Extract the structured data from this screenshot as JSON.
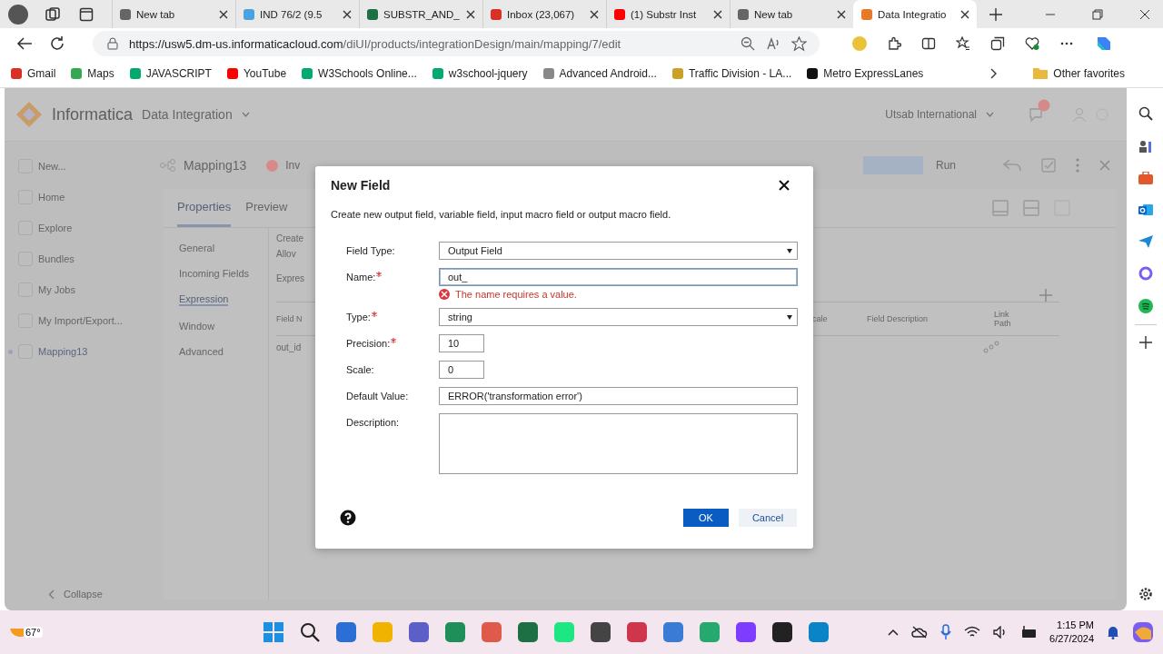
{
  "browser": {
    "tabs": [
      {
        "title": "New tab",
        "kind": "page",
        "selected": false
      },
      {
        "title": "IND 76/2 (9.5",
        "kind": "globe",
        "selected": false
      },
      {
        "title": "SUBSTR_AND_",
        "kind": "sheet",
        "selected": false
      },
      {
        "title": "Inbox (23,067)",
        "kind": "mail",
        "selected": false
      },
      {
        "title": "(1) Substr Inst",
        "kind": "video",
        "selected": false
      },
      {
        "title": "New tab",
        "kind": "page",
        "selected": false
      },
      {
        "title": "Data Integratio",
        "kind": "diamond",
        "selected": true
      }
    ],
    "url_host": "https://usw5.dm-us.informaticacloud.com",
    "url_path": "/diUI/products/integrationDesign/main/mapping/7/edit",
    "bookmarks": [
      {
        "label": "Gmail",
        "kind": "mail"
      },
      {
        "label": "Maps",
        "kind": "pin"
      },
      {
        "label": "JAVASCRIPT",
        "kind": "w3"
      },
      {
        "label": "YouTube",
        "kind": "video"
      },
      {
        "label": "W3Schools Online...",
        "kind": "w3"
      },
      {
        "label": "w3school-jquery",
        "kind": "w3"
      },
      {
        "label": "Advanced Android...",
        "kind": "g"
      },
      {
        "label": "Traffic Division - LA...",
        "kind": "building"
      },
      {
        "label": "Metro ExpressLanes",
        "kind": "metro"
      }
    ],
    "other_favorites": "Other favorites"
  },
  "app": {
    "logo": "Informatica",
    "product": "Data Integration",
    "org": "Utsab International",
    "sidebar": [
      {
        "label": "New...",
        "selected": false
      },
      {
        "label": "Home",
        "selected": false
      },
      {
        "label": "Explore",
        "selected": false
      },
      {
        "label": "Bundles",
        "selected": false
      },
      {
        "label": "My Jobs",
        "selected": false
      },
      {
        "label": "My Import/Export...",
        "selected": false
      },
      {
        "label": "Mapping13",
        "selected": true
      }
    ],
    "collapse": "Collapse",
    "mapping_name": "Mapping13",
    "status": "Inv",
    "run": "Run",
    "tabs": [
      {
        "label": "Properties",
        "selected": true
      },
      {
        "label": "Preview",
        "selected": false
      }
    ],
    "nav": [
      {
        "label": "General",
        "selected": false
      },
      {
        "label": "Incoming Fields",
        "selected": false
      },
      {
        "label": "Expression",
        "selected": true
      },
      {
        "label": "Window",
        "selected": false
      },
      {
        "label": "Advanced",
        "selected": false
      }
    ],
    "content_texts": [
      "Create",
      "Allov",
      "Expres"
    ],
    "columns": [
      "Field N",
      "cale",
      "Field Description",
      "Link Path"
    ],
    "row_cell": "out_id"
  },
  "dialog": {
    "title": "New Field",
    "description": "Create new output field, variable field, input macro field or output macro field.",
    "fields": [
      {
        "label": "Field Type:",
        "required": false,
        "kind": "select",
        "value": "Output Field"
      },
      {
        "label": "Name:",
        "required": true,
        "kind": "text",
        "value": "out_",
        "focused": true,
        "error": "The name requires a value."
      },
      {
        "label": "Type:",
        "required": true,
        "kind": "select",
        "value": "string"
      },
      {
        "label": "Precision:",
        "required": true,
        "kind": "short",
        "value": "10"
      },
      {
        "label": "Scale:",
        "required": false,
        "kind": "short",
        "value": "0"
      },
      {
        "label": "Default Value:",
        "required": false,
        "kind": "text",
        "value": "ERROR('transformation error')",
        "focused": false
      },
      {
        "label": "Description:",
        "required": false,
        "kind": "area"
      }
    ],
    "ok": "OK",
    "cancel": "Cancel"
  },
  "taskbar": {
    "weather": "67°",
    "time": "1:15 PM",
    "date": "6/27/2024"
  }
}
